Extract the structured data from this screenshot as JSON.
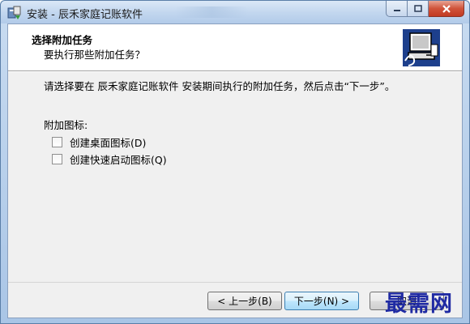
{
  "window": {
    "title": "安装 - 辰禾家庭记账软件"
  },
  "header": {
    "title": "选择附加任务",
    "subtitle": "要执行那些附加任务？"
  },
  "main": {
    "description": "请选择要在 辰禾家庭记账软件 安装期间执行的附加任务，然后点击“下一步”。",
    "group_label": "附加图标:",
    "options": [
      {
        "label": "创建桌面图标(D)",
        "checked": false
      },
      {
        "label": "创建快速启动图标(Q)",
        "checked": false
      }
    ]
  },
  "footer": {
    "back_label": "< 上一步(B)",
    "next_label": "下一步(N) >",
    "cancel_label": "取消"
  },
  "watermark": {
    "text": "最需网"
  },
  "colors": {
    "accent": "#3c7fb1",
    "watermark": "#1f2aa3",
    "close_button": "#c23a22"
  }
}
